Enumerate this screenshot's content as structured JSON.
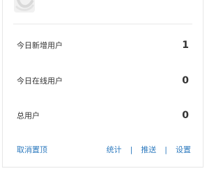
{
  "card": {
    "thumbnail_icon": "placeholder-image-icon",
    "stats": [
      {
        "label": "今日新增用户",
        "value": "1"
      },
      {
        "label": "今日在线用户",
        "value": "0"
      },
      {
        "label": "总用户",
        "value": "0"
      }
    ],
    "footer": {
      "unpin_label": "取消置顶",
      "actions": [
        "统计",
        "推送",
        "设置"
      ],
      "separator": "|"
    },
    "colors": {
      "link": "#2f7bbf",
      "text": "#333333",
      "divider": "#e8e8e8"
    }
  }
}
